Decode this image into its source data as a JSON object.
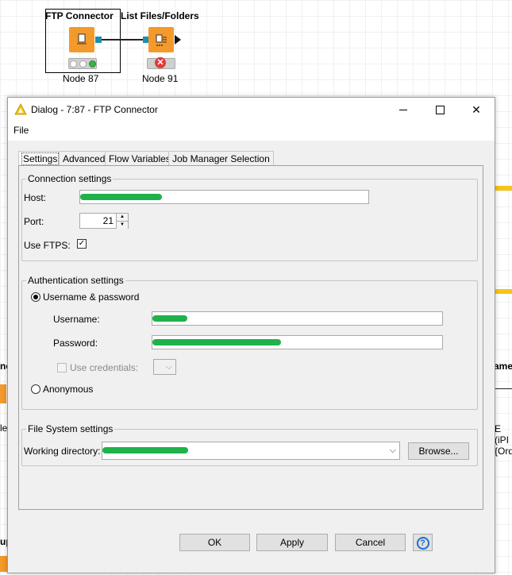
{
  "canvas": {
    "node1": {
      "title": "FTP Connector",
      "label": "Node 87"
    },
    "node2": {
      "title": "List Files/Folders",
      "label": "Node 91"
    },
    "partial_texts": {
      "left_mid": "ne",
      "left_low": "le",
      "left_bottom": "up",
      "right_mid": "ame",
      "right_e": "E",
      "right_ipi": "(iPI",
      "right_ord": "{Ord"
    }
  },
  "dialog": {
    "title": "Dialog - 7:87 - FTP Connector",
    "menu": [
      "File"
    ],
    "tabs": [
      "Settings",
      "Advanced",
      "Flow Variables",
      "Job Manager Selection"
    ],
    "connection": {
      "legend": "Connection settings",
      "host_label": "Host:",
      "port_label": "Port:",
      "port_value": "21",
      "ftps_label": "Use FTPS:",
      "ftps_checked": true
    },
    "auth": {
      "legend": "Authentication settings",
      "userpass_label": "Username & password",
      "username_label": "Username:",
      "password_label": "Password:",
      "use_credentials_label": "Use credentials:",
      "anonymous_label": "Anonymous",
      "selected": "Username & password"
    },
    "filesystem": {
      "legend": "File System settings",
      "workdir_label": "Working directory:",
      "browse_label": "Browse..."
    },
    "buttons": {
      "ok": "OK",
      "apply": "Apply",
      "cancel": "Cancel",
      "help": "?"
    }
  },
  "colors": {
    "node_orange": "#f39a2b",
    "port_blue": "#1a8fb0",
    "redaction_green": "#1fb24a",
    "canvas_yellow": "#f5c518",
    "help_blue": "#1e6fd0"
  }
}
